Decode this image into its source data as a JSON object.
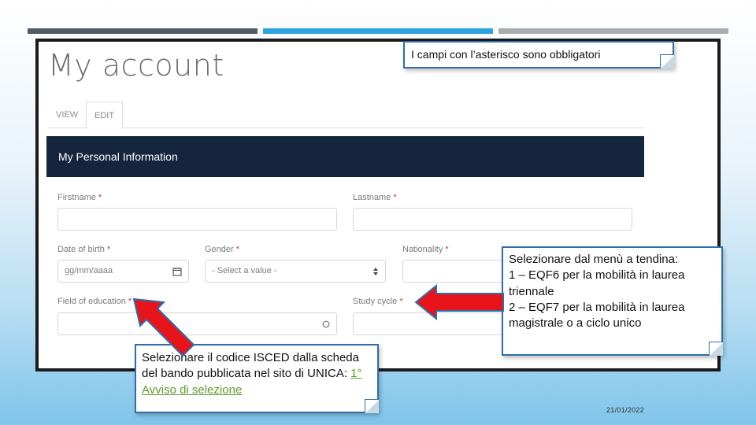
{
  "account": {
    "title": "My account",
    "tabs": [
      {
        "label": "VIEW"
      },
      {
        "label": "EDIT"
      }
    ],
    "section_title": "My Personal Information",
    "fields": {
      "firstname": {
        "label": "Firstname",
        "required": "*",
        "value": ""
      },
      "lastname": {
        "label": "Lastname",
        "required": "*",
        "value": ""
      },
      "date_of_birth": {
        "label": "Date of birth",
        "required": "*",
        "placeholder": "gg/mm/aaaa"
      },
      "gender": {
        "label": "Gender",
        "required": "*",
        "selected": "- Select a value -"
      },
      "nationality": {
        "label": "Nationality",
        "required": "*"
      },
      "field_of_education": {
        "label": "Field of education",
        "required": "*"
      },
      "study_cycle": {
        "label": "Study cycle",
        "required": "*"
      }
    }
  },
  "callouts": {
    "top": "I campi con l’asterisco sono obbligatori",
    "right_lines": [
      "Selezionare dal menù a tendina:",
      "1 – EQF6 per la mobilità in laurea triennale",
      "2 – EQF7 per la mobilità in laurea magistrale o a ciclo unico"
    ],
    "left_text": "Selezionare il codice ISCED dalla scheda del bando pubblicata nel sito di UNICA: ",
    "left_link": "1° Avviso di selezione"
  },
  "footer_date": "21/01/2022",
  "colors": {
    "arrow_fill": "#e8141c",
    "arrow_stroke": "#2f6ea8",
    "header_bg": "#16253e",
    "link": "#5a9e2a",
    "accent_bar": "#2ea3dd"
  },
  "icons": {
    "calendar": "calendar-icon",
    "select_arrow": "sort-arrows-icon",
    "search": "search-icon"
  }
}
